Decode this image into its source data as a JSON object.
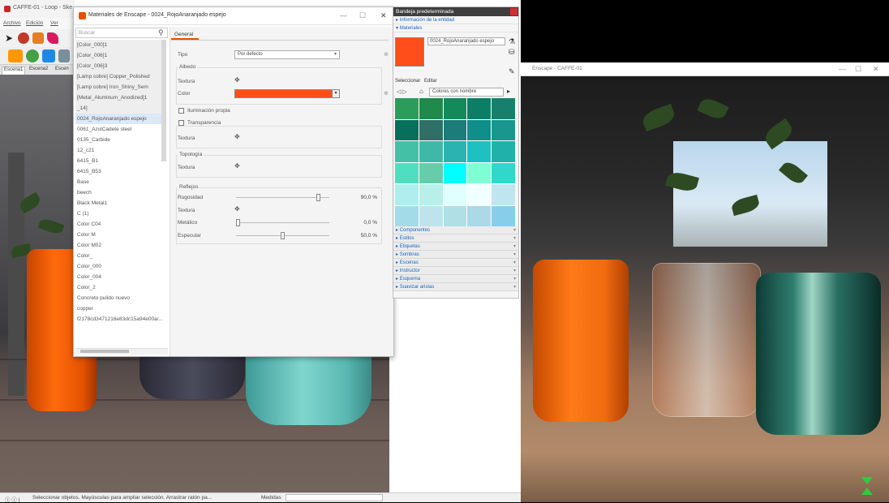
{
  "sketchup": {
    "title": "CAFFE-01 - Loop - Ske",
    "menu": [
      "Archivo",
      "Edición",
      "Ver"
    ],
    "scene_tabs": [
      "Escena1",
      "Escena2",
      "Escen"
    ],
    "status_text": "Seleccionar objetos. Mayúsculas para ampliar selección. Arrastrar ratón pa...",
    "measure_label": "Medidas"
  },
  "dialog": {
    "title": "Materiales de Enscape - 0024_RojoAnaranjado espejo",
    "search_placeholder": "Buscar",
    "materials": [
      "[Color_000]1",
      "[Color_006]1",
      "[Color_006]3",
      "[Lamp cobre] Copper_Polished",
      "[Lamp cobre] Iron_Shiny_Sem",
      "[Metal_Aluminum_Anodized]1",
      "_14]",
      "0024_RojoAnaranjado espejo",
      "0061_AzulCadete steel",
      "0135_Carbide",
      "12_c21",
      "6415_B1",
      "6415_B53",
      "Base",
      "beech",
      "Black Metal1",
      "C (1)",
      "Color C04",
      "Color M",
      "Color M02",
      "Color_",
      "Color_000",
      "Color_004",
      "Color_2",
      "Concreto pulido nuevo",
      "copper",
      "f2178cd3471216e83dc15a94e00a/..."
    ],
    "selected_index": 7,
    "tab_general": "General",
    "tipo_label": "Tipo",
    "tipo_value": "Por defecto",
    "albedo_label": "Albedo",
    "textura_label": "Textura",
    "color_label": "Color",
    "albedo_color": "#ff4e1a",
    "iluminacion_label": "Iluminación propia",
    "transparencia_label": "Transparencia",
    "topologia_label": "Topología",
    "reflejos_label": "Reflejos",
    "rugosidad_label": "Rugosidad",
    "rugosidad_value": "90,0 %",
    "rugosidad_fraction": 0.9,
    "metalico_label": "Metálico",
    "metalico_value": "0,0 %",
    "metalico_fraction": 0.0,
    "especular_label": "Especular",
    "especular_value": "50,0 %",
    "especular_fraction": 0.5
  },
  "tray": {
    "title": "Bandeja predeterminada",
    "entity_info": "Información de la entidad",
    "materials_section": "Materiales",
    "material_name": "0024_RojoAnaranjado espejo",
    "tab_select": "Seleccionar",
    "tab_edit": "Editar",
    "collection": "Colores con nombre",
    "sections": [
      "Componentes",
      "Estilos",
      "Etiquetas",
      "Sombras",
      "Escenas",
      "Instructor",
      "Esquema",
      "Suavizar aristas"
    ],
    "swatches": [
      "#2a9d5b",
      "#1f8a4c",
      "#128a5a",
      "#0a7f66",
      "#17806c",
      "#06705a",
      "#2f6f66",
      "#1b7c7a",
      "#0f8e8a",
      "#19968d",
      "#43c0a5",
      "#3fb8a8",
      "#2ab3b0",
      "#1fc0c0",
      "#20b2aa",
      "#4fdfc0",
      "#66cdaa",
      "#00ffff",
      "#7fffd4",
      "#2fd8c8",
      "#afeeee",
      "#b9efe9",
      "#e0ffff",
      "#f0ffff",
      "#bfe6ef",
      "#a4dbe8",
      "#bfe3ec",
      "#b0e0e6",
      "#add8e6",
      "#87ceeb"
    ]
  },
  "enscape": {
    "title": "Enscape - CAFFE-01"
  }
}
